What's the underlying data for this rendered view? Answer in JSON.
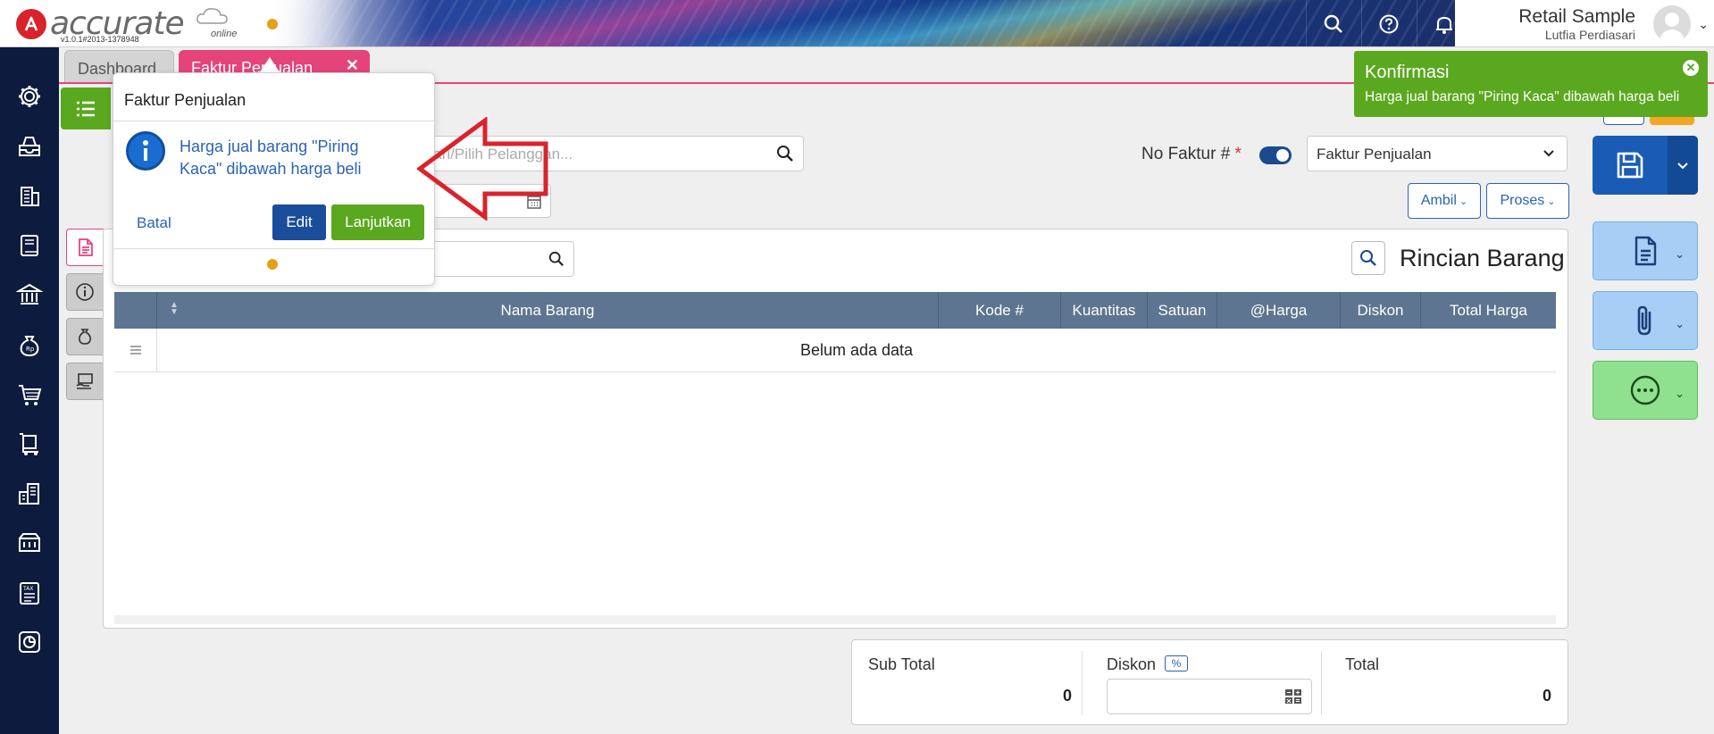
{
  "app": {
    "logo_text": "accurate",
    "logo_sub": "online",
    "version": "v1.0.1#2013-1378948"
  },
  "user": {
    "company": "Retail Sample",
    "name": "Lutfia Perdiasari"
  },
  "tabs": [
    {
      "label": "Dashboard"
    },
    {
      "label": "Faktur Penjualan",
      "close": "✕"
    }
  ],
  "form": {
    "customer_placeholder": "Cari/Pilih Pelanggan...",
    "no_faktur_label": "No Faktur #",
    "required_mark": "*",
    "type_select": "Faktur Penjualan",
    "ambil_label": "Ambil",
    "proses_label": "Proses"
  },
  "items": {
    "title": "Rincian Barang",
    "columns": [
      "Nama Barang",
      "Kode #",
      "Kuantitas",
      "Satuan",
      "@Harga",
      "Diskon",
      "Total Harga"
    ],
    "empty": "Belum ada data"
  },
  "totals": {
    "subtotal_label": "Sub Total",
    "subtotal_value": "0",
    "diskon_label": "Diskon",
    "diskon_badge": "%",
    "total_label": "Total",
    "total_value": "0"
  },
  "popover": {
    "title": "Faktur Penjualan",
    "message": "Harga jual barang \"Piring Kaca\" dibawah harga beli",
    "cancel": "Batal",
    "edit": "Edit",
    "continue": "Lanjutkan"
  },
  "toast": {
    "title": "Konfirmasi",
    "message": "Harga jual barang \"Piring Kaca\" dibawah harga beli",
    "close": "✕"
  },
  "colors": {
    "brand_red": "#d8232a",
    "tab_pink": "#e5447a",
    "primary_blue": "#1a5cb5",
    "success_green": "#5aa81f",
    "nav_dark": "#0d1b3e",
    "table_header": "#5d7590",
    "accent_orange": "#e6a015"
  },
  "icons": {
    "nav": [
      "gear-icon",
      "inbox-icon",
      "building-icon",
      "book-icon",
      "bank-icon",
      "money-bag-icon",
      "cart-icon",
      "delivery-icon",
      "warehouse-icon",
      "factory-icon",
      "tax-icon",
      "report-icon"
    ]
  }
}
